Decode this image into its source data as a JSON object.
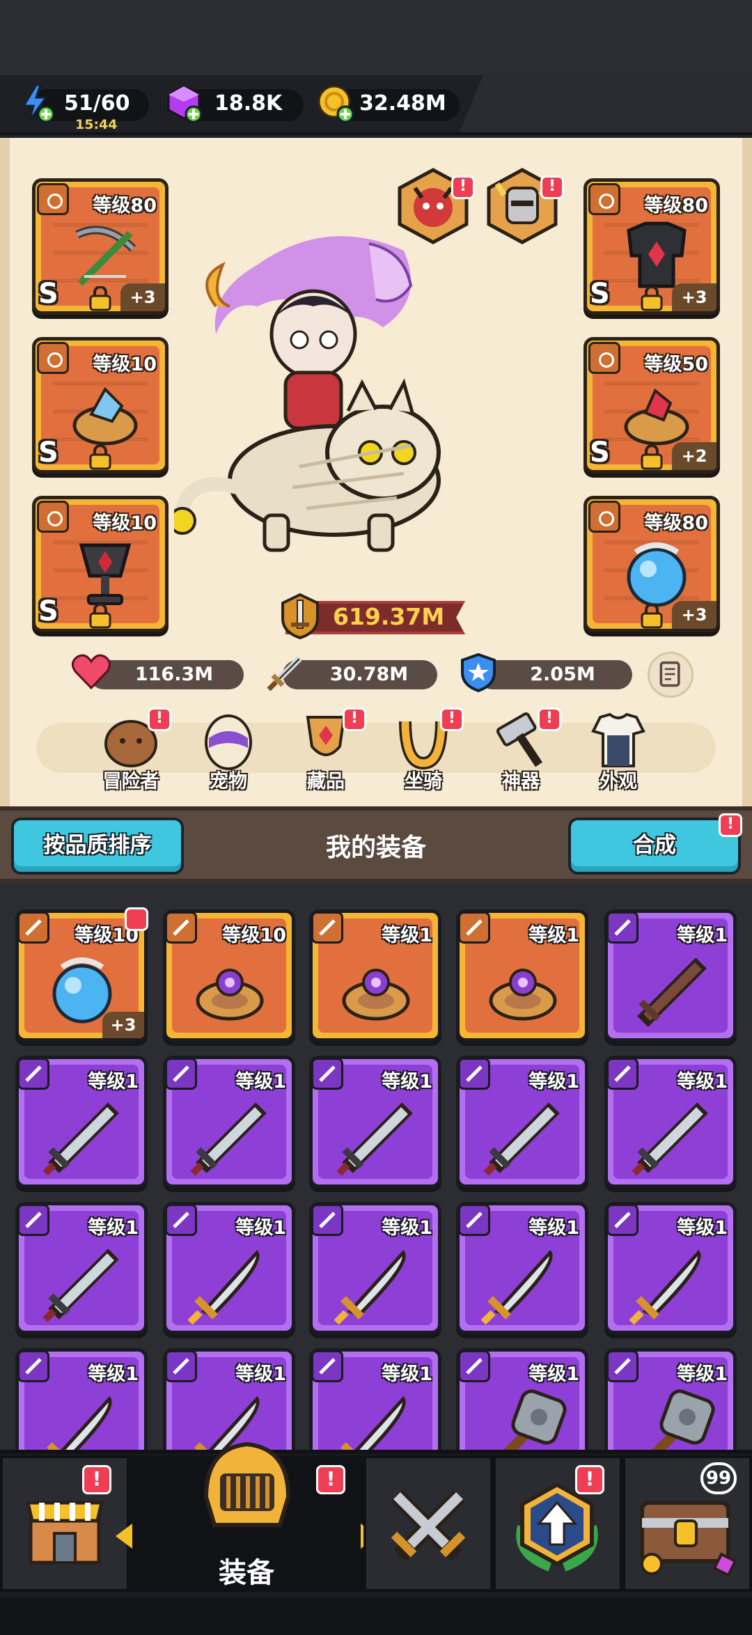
{
  "resources": {
    "energy": {
      "value": "51/60",
      "timer": "15:44",
      "icon": "lightning-plus-icon"
    },
    "gems": {
      "value": "18.8K",
      "icon": "purple-gem-plus-icon"
    },
    "coins": {
      "value": "32.48M",
      "icon": "gold-coin-plus-icon"
    }
  },
  "hero": {
    "left_slots": [
      {
        "type": "weapon",
        "level": "等级80",
        "grade": "S",
        "plus": "+3",
        "locked": true
      },
      {
        "type": "ring",
        "level": "等级10",
        "grade": "S",
        "plus": "",
        "locked": true
      },
      {
        "type": "necklace",
        "level": "等级10",
        "grade": "S",
        "plus": "",
        "locked": true
      }
    ],
    "right_slots": [
      {
        "type": "armor",
        "level": "等级80",
        "grade": "S",
        "plus": "+3",
        "locked": true
      },
      {
        "type": "ring",
        "level": "等级50",
        "grade": "S",
        "plus": "+2",
        "locked": true
      },
      {
        "type": "necklace",
        "level": "等级80",
        "grade": "",
        "plus": "+3",
        "locked": true
      }
    ],
    "pets": [
      {
        "name": "red-demon-pet-icon",
        "badge": "!"
      },
      {
        "name": "golden-knight-pet-icon",
        "badge": "!"
      }
    ],
    "power": "619.37M",
    "stats": {
      "hp": "116.3M",
      "attack": "30.78M",
      "defense": "2.05M"
    },
    "menu": [
      {
        "label": "冒险者",
        "icon": "capybara-icon",
        "badge": "!"
      },
      {
        "label": "宠物",
        "icon": "egg-icon",
        "badge": ""
      },
      {
        "label": "藏品",
        "icon": "trophy-shield-icon",
        "badge": "!"
      },
      {
        "label": "坐骑",
        "icon": "horseshoe-icon",
        "badge": "!"
      },
      {
        "label": "神器",
        "icon": "hammer-icon",
        "badge": "!"
      },
      {
        "label": "外观",
        "icon": "outfit-icon",
        "badge": ""
      }
    ]
  },
  "equipment": {
    "sort_label": "按品质排序",
    "title": "我的装备",
    "merge_label": "合成",
    "merge_badge": "!",
    "items": [
      {
        "rarity": "orange",
        "kind": "orb",
        "level": "等级10",
        "plus": "+3",
        "flag": true
      },
      {
        "rarity": "orange",
        "kind": "ring",
        "level": "等级10",
        "plus": "",
        "flag": false
      },
      {
        "rarity": "orange",
        "kind": "ring",
        "level": "等级1",
        "plus": "",
        "flag": false
      },
      {
        "rarity": "orange",
        "kind": "ring",
        "level": "等级1",
        "plus": "",
        "flag": false
      },
      {
        "rarity": "purple",
        "kind": "wood-sword",
        "level": "等级1",
        "plus": "",
        "flag": false
      },
      {
        "rarity": "purple",
        "kind": "steel-sword",
        "level": "等级1",
        "plus": "",
        "flag": false
      },
      {
        "rarity": "purple",
        "kind": "steel-sword",
        "level": "等级1",
        "plus": "",
        "flag": false
      },
      {
        "rarity": "purple",
        "kind": "steel-sword",
        "level": "等级1",
        "plus": "",
        "flag": false
      },
      {
        "rarity": "purple",
        "kind": "steel-sword",
        "level": "等级1",
        "plus": "",
        "flag": false
      },
      {
        "rarity": "purple",
        "kind": "steel-sword",
        "level": "等级1",
        "plus": "",
        "flag": false
      },
      {
        "rarity": "purple",
        "kind": "steel-sword",
        "level": "等级1",
        "plus": "",
        "flag": false
      },
      {
        "rarity": "purple",
        "kind": "gold-sword",
        "level": "等级1",
        "plus": "",
        "flag": false
      },
      {
        "rarity": "purple",
        "kind": "gold-sword",
        "level": "等级1",
        "plus": "",
        "flag": false
      },
      {
        "rarity": "purple",
        "kind": "gold-sword",
        "level": "等级1",
        "plus": "",
        "flag": false
      },
      {
        "rarity": "purple",
        "kind": "gold-sword",
        "level": "等级1",
        "plus": "",
        "flag": false
      },
      {
        "rarity": "purple",
        "kind": "gold-sword",
        "level": "等级1",
        "plus": "",
        "flag": false
      },
      {
        "rarity": "purple",
        "kind": "gold-sword",
        "level": "等级1",
        "plus": "",
        "flag": false
      },
      {
        "rarity": "purple",
        "kind": "gold-sword",
        "level": "等级1",
        "plus": "",
        "flag": false
      },
      {
        "rarity": "purple",
        "kind": "stone-mace",
        "level": "等级1",
        "plus": "",
        "flag": false
      },
      {
        "rarity": "purple",
        "kind": "stone-mace",
        "level": "等级1",
        "plus": "",
        "flag": false
      }
    ]
  },
  "nav": {
    "tabs": [
      {
        "icon": "shop-icon",
        "label": "",
        "badge": "!"
      },
      {
        "icon": "knight-helmet-icon",
        "label": "装备",
        "badge": "!"
      },
      {
        "icon": "crossed-swords-icon",
        "label": "",
        "badge": ""
      },
      {
        "icon": "upgrade-arrow-icon",
        "label": "",
        "badge": "!"
      },
      {
        "icon": "treasure-chest-icon",
        "label": "",
        "badge": "99"
      }
    ]
  },
  "colors": {
    "slot_gold": "#f5b634",
    "slot_orange": "#e2703e",
    "card_purple": "#8e3fd6",
    "accent_cyan": "#3fc7e0",
    "alert_red": "#ef3d53",
    "power_gold": "#ffd24d"
  }
}
